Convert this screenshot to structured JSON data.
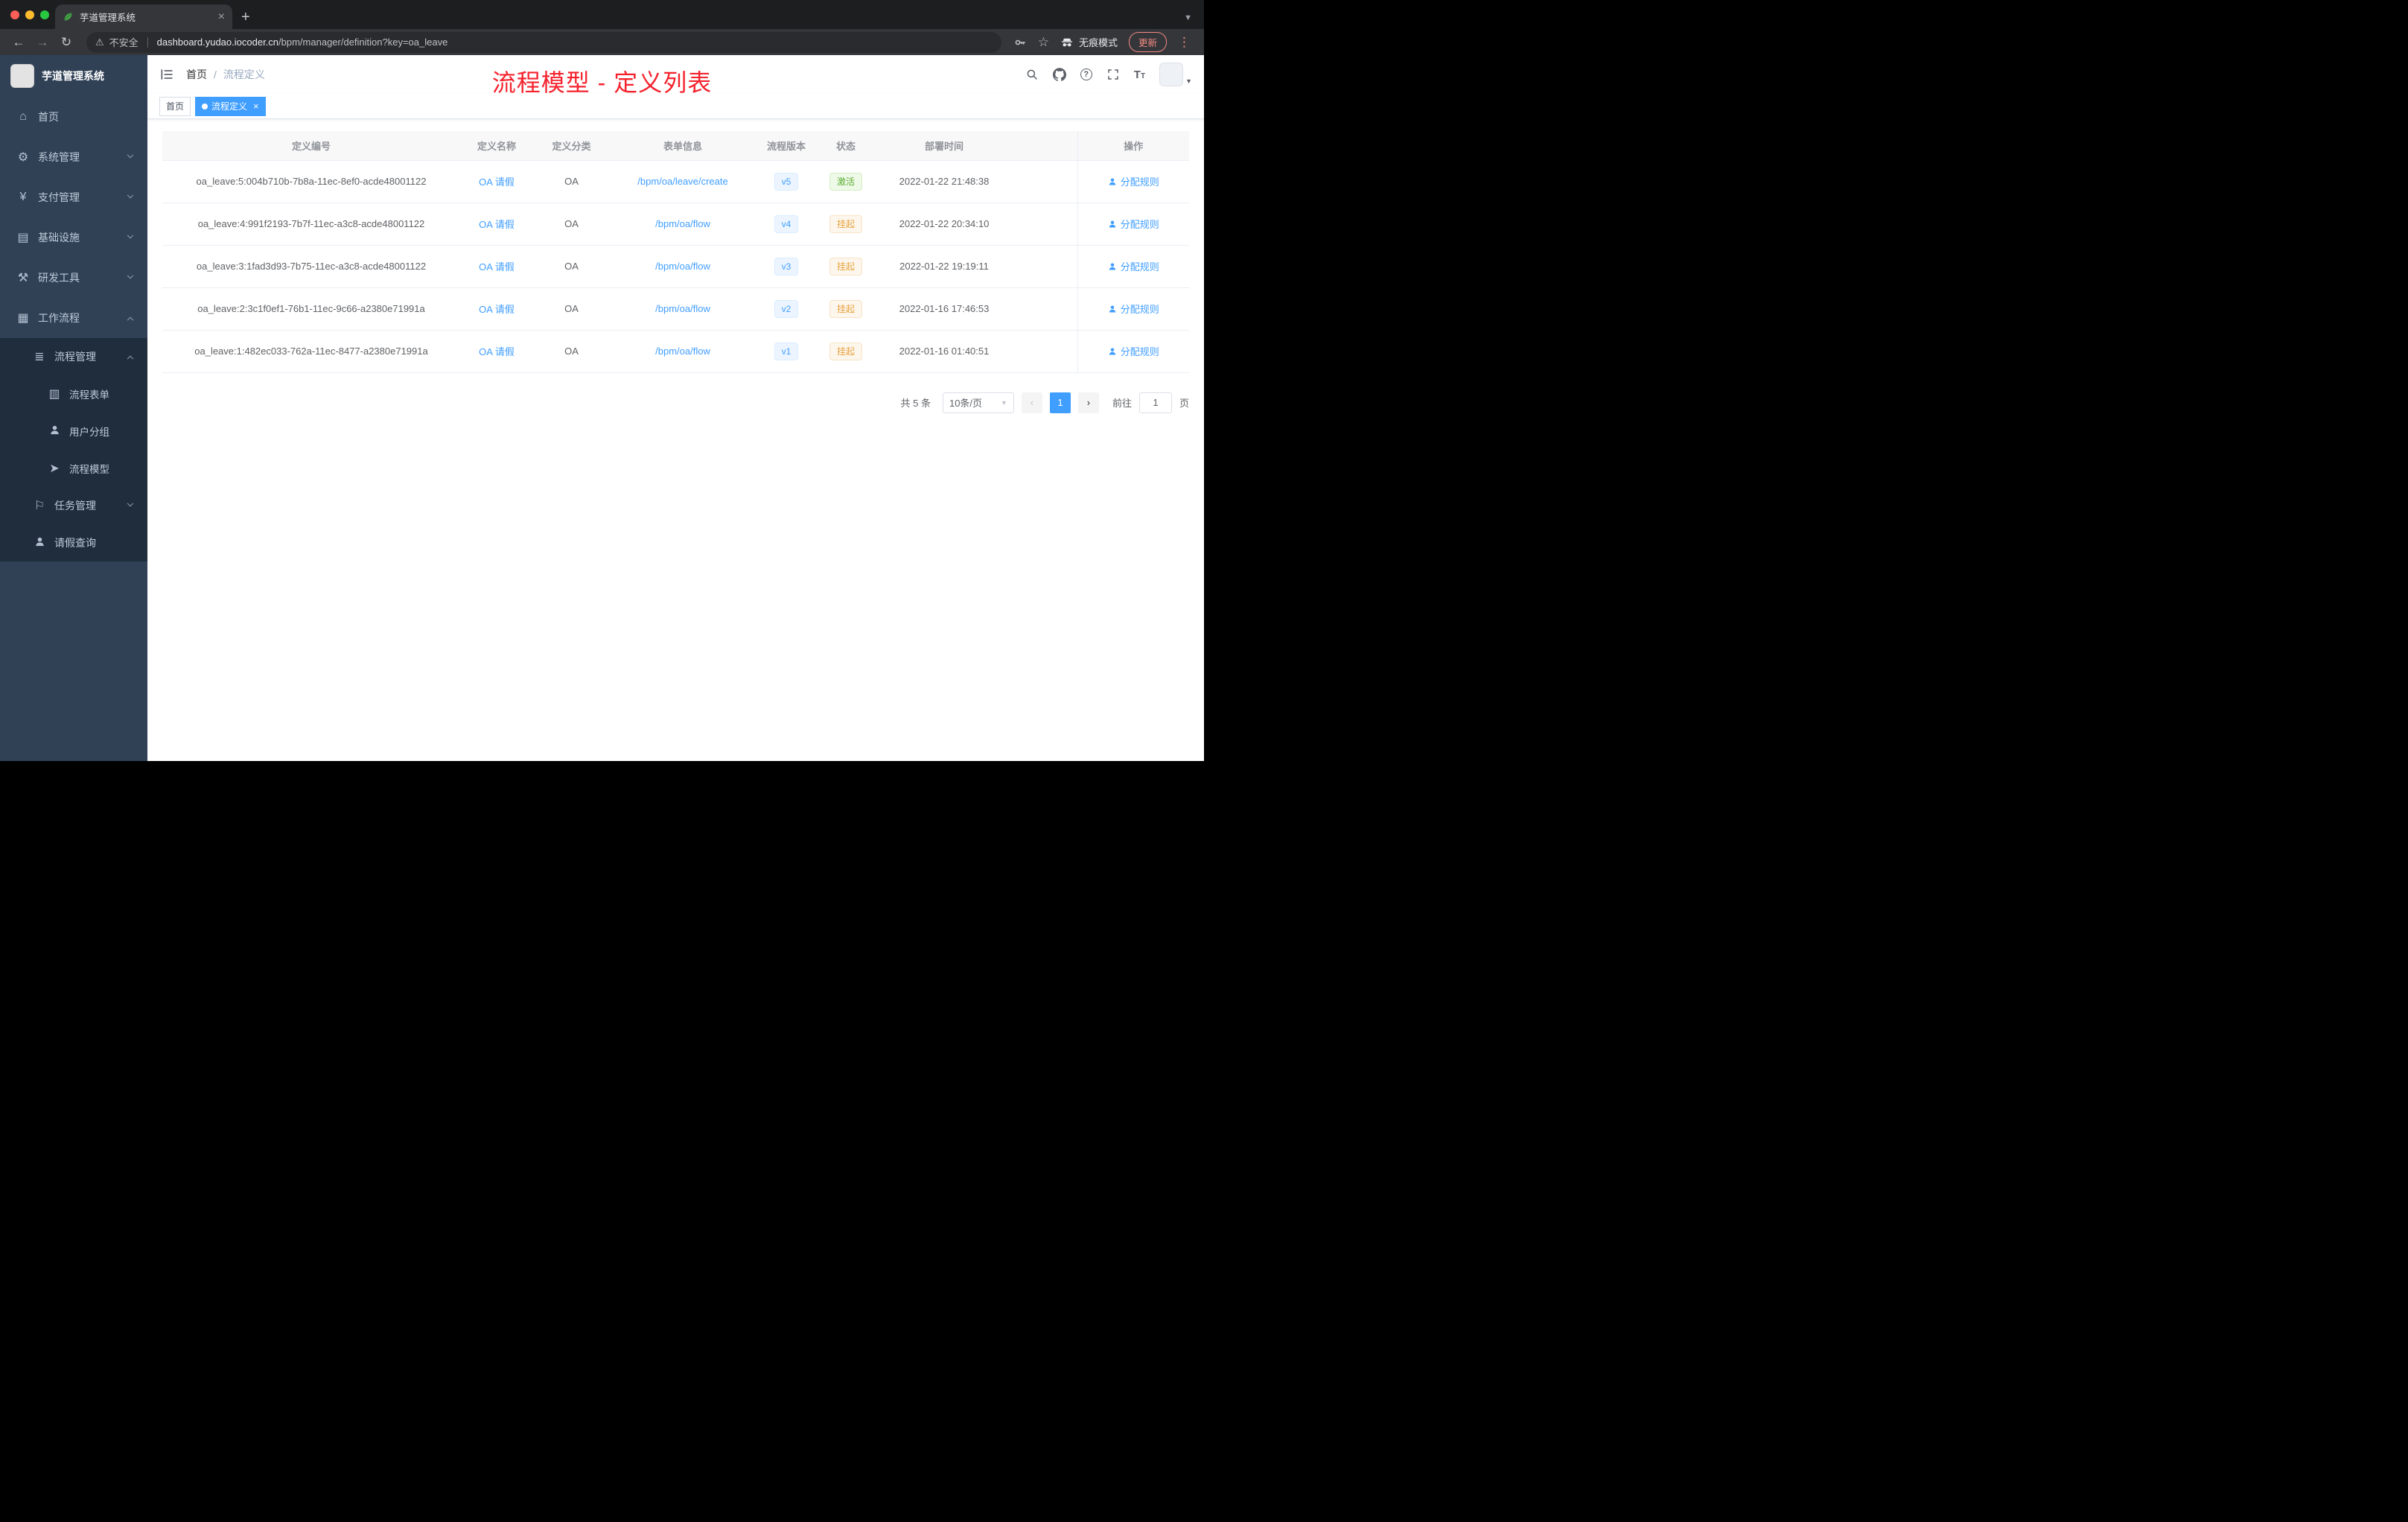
{
  "colors": {
    "accent": "#409eff",
    "success": "#5daf34",
    "warning": "#e6a23c",
    "annotation_red": "#f5222d",
    "sidebar_bg": "#304156",
    "submenu_bg": "#1f2d3d"
  },
  "browser": {
    "tab_title": "芋道管理系统",
    "security_label": "不安全",
    "url_domain": "dashboard.yudao.iocoder.cn",
    "url_path": "/bpm/manager/definition?key=oa_leave",
    "incognito_label": "无痕模式",
    "update_label": "更新"
  },
  "sidebar": {
    "app_title": "芋道管理系统",
    "items": [
      {
        "icon": "dashboard-icon",
        "label": "首页",
        "level": 0
      },
      {
        "icon": "gear-icon",
        "label": "系统管理",
        "level": 0,
        "expandable": true,
        "expanded": false
      },
      {
        "icon": "payment-icon",
        "label": "支付管理",
        "level": 0,
        "expandable": true,
        "expanded": false
      },
      {
        "icon": "infrastructure-icon",
        "label": "基础设施",
        "level": 0,
        "expandable": true,
        "expanded": false
      },
      {
        "icon": "dev-tools-icon",
        "label": "研发工具",
        "level": 0,
        "expandable": true,
        "expanded": false
      },
      {
        "icon": "workflow-icon",
        "label": "工作流程",
        "level": 0,
        "expandable": true,
        "expanded": true
      },
      {
        "icon": "process-manage-icon",
        "label": "流程管理",
        "level": 1,
        "expandable": true,
        "expanded": true
      },
      {
        "icon": "process-form-icon",
        "label": "流程表单",
        "level": 2
      },
      {
        "icon": "user-group-icon",
        "label": "用户分组",
        "level": 2
      },
      {
        "icon": "process-model-icon",
        "label": "流程模型",
        "level": 2
      },
      {
        "icon": "task-manage-icon",
        "label": "任务管理",
        "level": 1,
        "expandable": true,
        "expanded": false
      },
      {
        "icon": "leave-query-icon",
        "label": "请假查询",
        "level": 1
      }
    ]
  },
  "header": {
    "breadcrumb": {
      "home": "首页",
      "current": "流程定义"
    },
    "annotation": "流程模型 - 定义列表"
  },
  "tags": {
    "items": [
      {
        "label": "首页",
        "active": false
      },
      {
        "label": "流程定义",
        "active": true
      }
    ]
  },
  "table": {
    "columns": [
      "定义编号",
      "定义名称",
      "定义分类",
      "表单信息",
      "流程版本",
      "状态",
      "部署时间",
      "操作"
    ],
    "rows": [
      {
        "id": "oa_leave:5:004b710b-7b8a-11ec-8ef0-acde48001122",
        "name": "OA 请假",
        "category": "OA",
        "form": "/bpm/oa/leave/create",
        "version": "v5",
        "status": "激活",
        "status_type": "success",
        "time": "2022-01-22 21:48:38",
        "action": "分配规则"
      },
      {
        "id": "oa_leave:4:991f2193-7b7f-11ec-a3c8-acde48001122",
        "name": "OA 请假",
        "category": "OA",
        "form": "/bpm/oa/flow",
        "version": "v4",
        "status": "挂起",
        "status_type": "warning",
        "time": "2022-01-22 20:34:10",
        "action": "分配规则"
      },
      {
        "id": "oa_leave:3:1fad3d93-7b75-11ec-a3c8-acde48001122",
        "name": "OA 请假",
        "category": "OA",
        "form": "/bpm/oa/flow",
        "version": "v3",
        "status": "挂起",
        "status_type": "warning",
        "time": "2022-01-22 19:19:11",
        "action": "分配规则"
      },
      {
        "id": "oa_leave:2:3c1f0ef1-76b1-11ec-9c66-a2380e71991a",
        "name": "OA 请假",
        "category": "OA",
        "form": "/bpm/oa/flow",
        "version": "v2",
        "status": "挂起",
        "status_type": "warning",
        "time": "2022-01-16 17:46:53",
        "action": "分配规则"
      },
      {
        "id": "oa_leave:1:482ec033-762a-11ec-8477-a2380e71991a",
        "name": "OA 请假",
        "category": "OA",
        "form": "/bpm/oa/flow",
        "version": "v1",
        "status": "挂起",
        "status_type": "warning",
        "time": "2022-01-16 01:40:51",
        "action": "分配规则"
      }
    ]
  },
  "pagination": {
    "total": "共 5 条",
    "page_size": "10条/页",
    "current_page": "1",
    "goto_label": "前往",
    "goto_value": "1",
    "unit": "页"
  }
}
